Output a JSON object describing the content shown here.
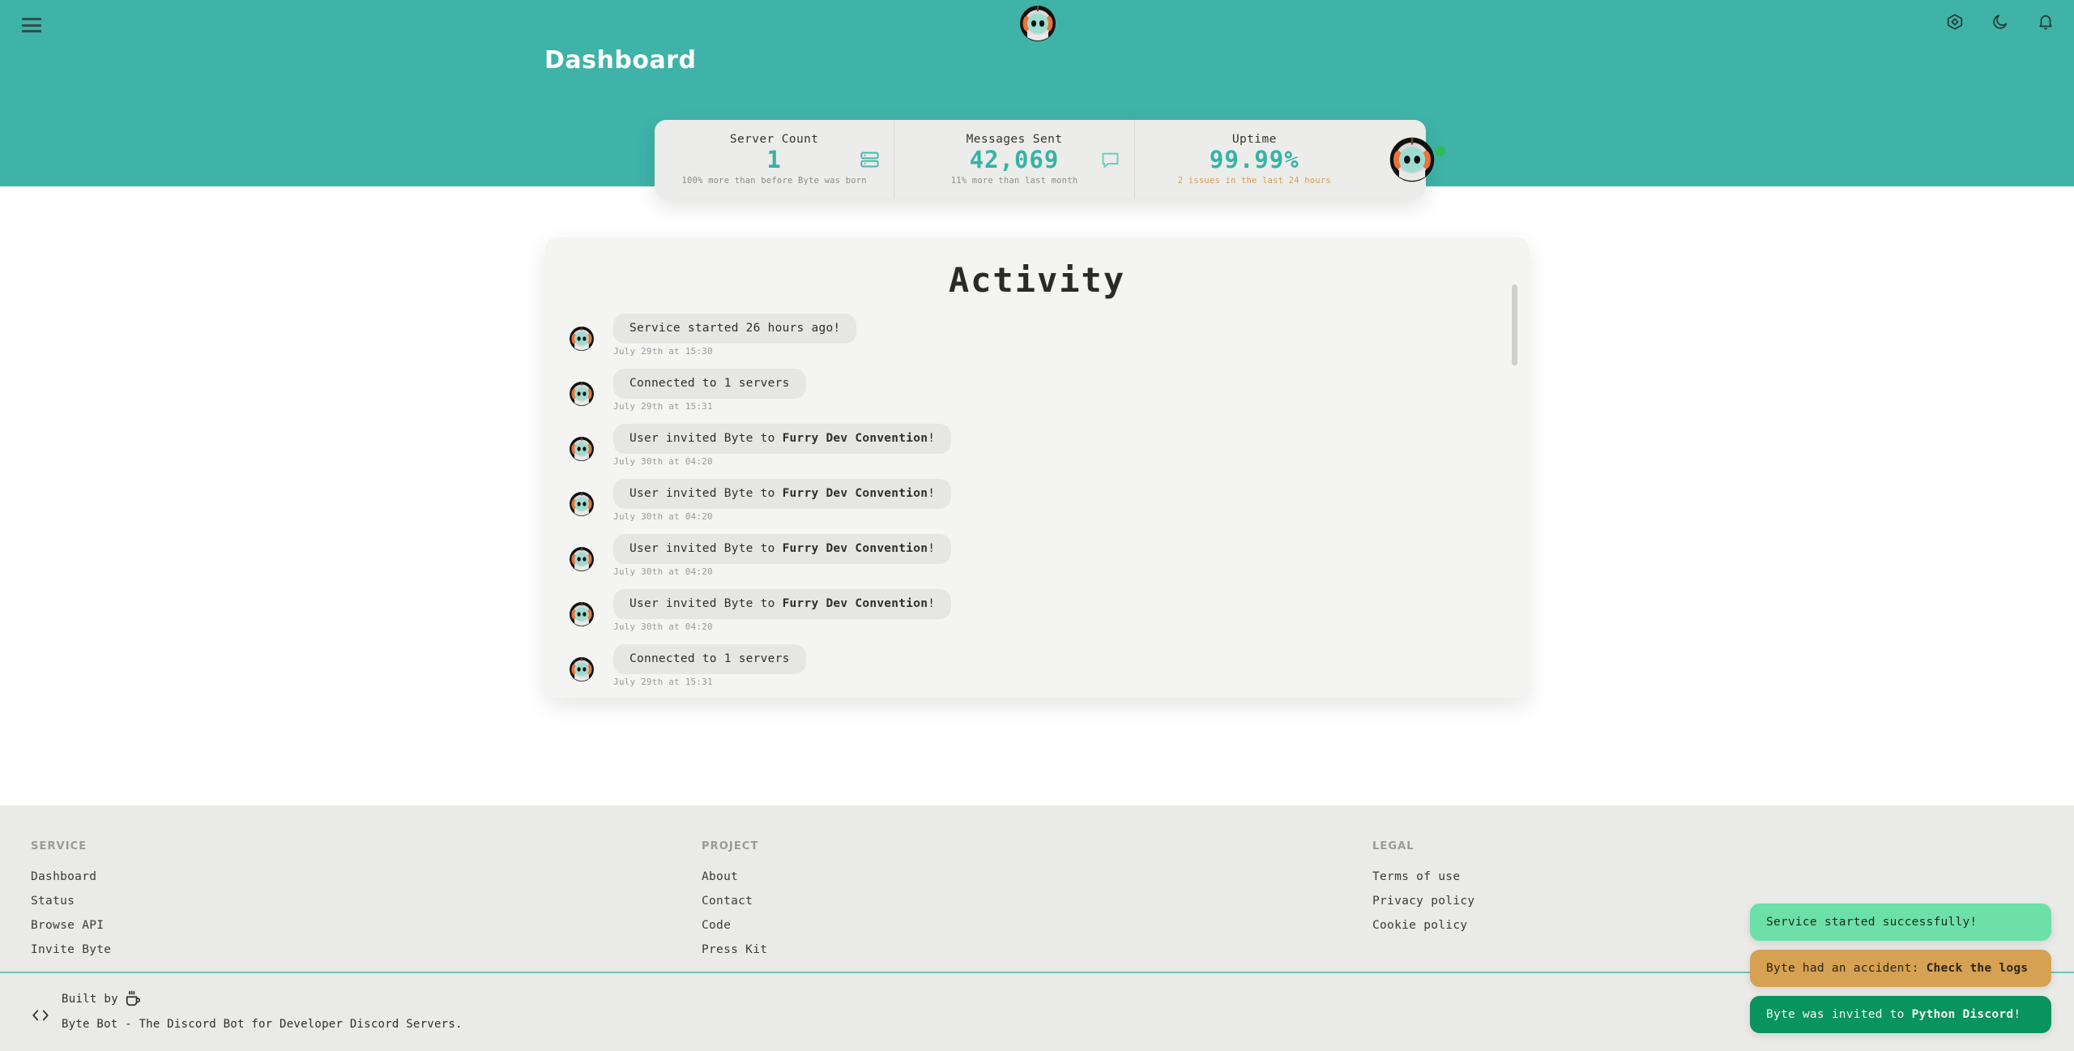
{
  "header": {
    "menu_icon": "hamburger-icon",
    "logo": "byte-bot-logo",
    "title": "Dashboard",
    "icons": [
      {
        "name": "box-icon",
        "label": "Browse API"
      },
      {
        "name": "moon-icon",
        "label": "Dark mode"
      },
      {
        "name": "bell-icon",
        "label": "Notifications"
      }
    ]
  },
  "stats": [
    {
      "label": "Server Count",
      "value": "1",
      "sub": "100% more than before Byte was born",
      "sub_kind": "muted",
      "icon": "server-stack-icon"
    },
    {
      "label": "Messages Sent",
      "value": "42,069",
      "sub": "11% more than last month",
      "sub_kind": "muted",
      "icon": "message-bubble-icon"
    },
    {
      "label": "Uptime",
      "value": "99.99%",
      "sub": "2 issues in the last 24 hours",
      "sub_kind": "warn",
      "icon": "bot-avatar-icon"
    }
  ],
  "activity": {
    "title": "Activity",
    "items": [
      {
        "text": "Service started 26 hours ago!",
        "bold": "",
        "suffix": "",
        "time": "July 29th at 15:30"
      },
      {
        "text": "Connected to 1 servers",
        "bold": "",
        "suffix": "",
        "time": "July 29th at 15:31"
      },
      {
        "text": "User invited Byte to ",
        "bold": "Furry Dev Convention",
        "suffix": "!",
        "time": "July 30th at 04:20"
      },
      {
        "text": "User invited Byte to ",
        "bold": "Furry Dev Convention",
        "suffix": "!",
        "time": "July 30th at 04:20"
      },
      {
        "text": "User invited Byte to ",
        "bold": "Furry Dev Convention",
        "suffix": "!",
        "time": "July 30th at 04:20"
      },
      {
        "text": "User invited Byte to ",
        "bold": "Furry Dev Convention",
        "suffix": "!",
        "time": "July 30th at 04:20"
      },
      {
        "text": "Connected to 1 servers",
        "bold": "",
        "suffix": "",
        "time": "July 29th at 15:31"
      }
    ]
  },
  "footer": {
    "columns": [
      {
        "title": "SERVICE",
        "links": [
          "Dashboard",
          "Status",
          "Browse API",
          "Invite Byte"
        ]
      },
      {
        "title": "PROJECT",
        "links": [
          "About",
          "Contact",
          "Code",
          "Press Kit"
        ]
      },
      {
        "title": "LEGAL",
        "links": [
          "Terms of use",
          "Privacy policy",
          "Cookie policy"
        ]
      }
    ],
    "built_by": "Built by",
    "coffee_icon": "coffee-cup-icon",
    "code_icon": "code-brackets-icon",
    "tagline": "Byte Bot - The Discord Bot for Developer Discord Servers."
  },
  "toasts": [
    {
      "kind": "success",
      "text": "Service started successfully!",
      "bold": "",
      "suffix": ""
    },
    {
      "kind": "warning",
      "text": "Byte had an accident: ",
      "bold": "Check the logs",
      "suffix": ""
    },
    {
      "kind": "info",
      "text": "Byte was invited to ",
      "bold": "Python Discord",
      "suffix": "!"
    }
  ],
  "colors": {
    "brand_teal": "#3fb3a8",
    "accent_teal": "#36b3a6",
    "warn_amber": "#d79e4e",
    "toast_success": "#6ce0a8",
    "toast_warning": "#d6a152",
    "toast_info": "#09935f",
    "footer_bg": "#eaeae8",
    "panel_bg": "#f4f4f2"
  }
}
